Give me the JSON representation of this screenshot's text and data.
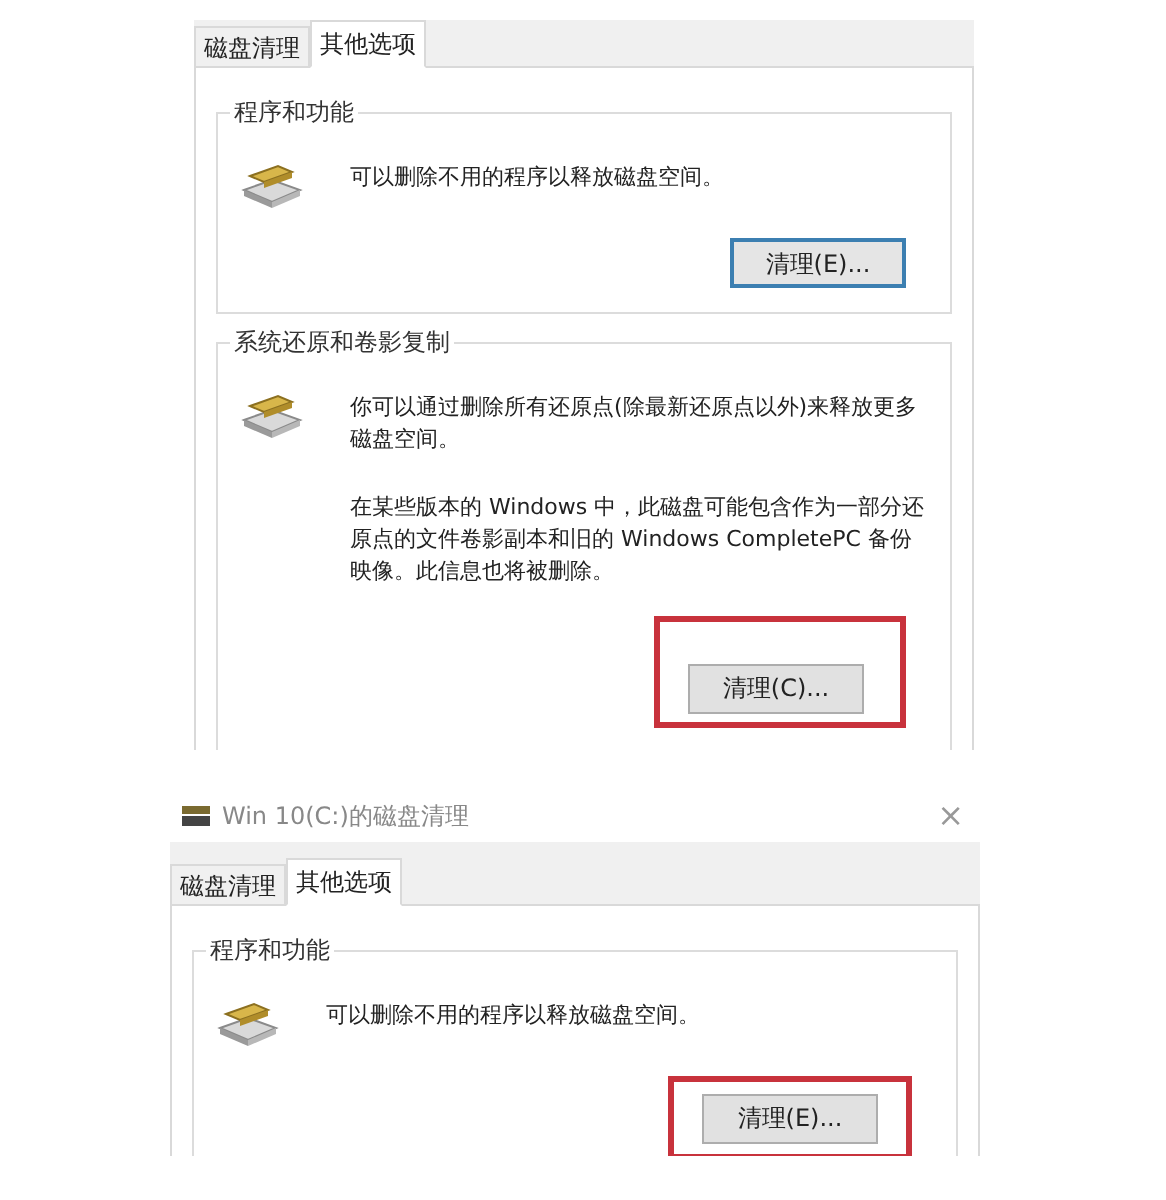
{
  "dialogs": [
    {
      "tabs": [
        {
          "label": "磁盘清理",
          "selected": false
        },
        {
          "label": "其他选项",
          "selected": true
        }
      ],
      "groups": [
        {
          "legend": "程序和功能",
          "paragraphs": [
            "可以删除不用的程序以释放磁盘空间。"
          ],
          "button": {
            "label": "清理(E)...",
            "focused": true,
            "highlighted": false
          }
        },
        {
          "legend": "系统还原和卷影复制",
          "paragraphs": [
            "你可以通过删除所有还原点(除最新还原点以外)来释放更多磁盘空间。",
            "在某些版本的 Windows 中，此磁盘可能包含作为一部分还原点的文件卷影副本和旧的 Windows CompletePC 备份映像。此信息也将被删除。"
          ],
          "button": {
            "label": "清理(C)...",
            "focused": false,
            "highlighted": true
          }
        }
      ]
    },
    {
      "title": "Win 10(C:)的磁盘清理",
      "close": "×",
      "tabs": [
        {
          "label": "磁盘清理",
          "selected": false
        },
        {
          "label": "其他选项",
          "selected": true
        }
      ],
      "groups": [
        {
          "legend": "程序和功能",
          "paragraphs": [
            "可以删除不用的程序以释放磁盘空间。"
          ],
          "button": {
            "label": "清理(E)...",
            "focused": false,
            "highlighted": true
          }
        }
      ]
    }
  ]
}
